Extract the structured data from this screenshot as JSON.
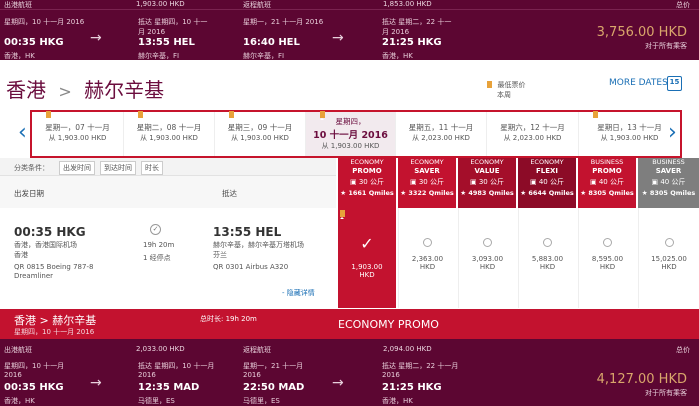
{
  "top_summary": {
    "out_label": "出港航班",
    "out_price": "1,903.00 HKD",
    "ret_label": "返程航班",
    "ret_price": "1,853.00 HKD",
    "total_label": "总价",
    "seg1": {
      "dep_date": "星期四，10 十一月 2016",
      "dep_time": "00:35 HKG",
      "dep_place": "香港，HK",
      "arr_date": "抵达 星期四，10 十一月 2016",
      "arr_time": "13:55 HEL",
      "arr_place": "赫尔辛基，FI"
    },
    "seg2": {
      "dep_date": "星期一，21 十一月 2016",
      "dep_time": "16:40 HEL",
      "dep_place": "赫尔辛基，FI",
      "arr_date": "抵达 星期二，22 十一月 2016",
      "arr_time": "21:25 HKG",
      "arr_place": "香港，HK"
    },
    "total_amount": "3,756.00 HKD",
    "total_note": "对于所有乘客"
  },
  "route": {
    "from": "香港",
    "to": "赫尔辛基",
    "sep": ">"
  },
  "legend": {
    "lowest_fare": "最低票价",
    "this_week": "本周"
  },
  "more_dates": "MORE DATES",
  "calendar_day": "15",
  "dates": [
    {
      "day": "星期一，07 十一月",
      "price": "从 1,903.00 HKD",
      "bookmark": true
    },
    {
      "day": "星期二，08 十一月",
      "price": "从 1,903.00 HKD",
      "bookmark": true
    },
    {
      "day": "星期三，09 十一月",
      "price": "从 1,903.00 HKD",
      "bookmark": true
    },
    {
      "day_line1": "星期四，",
      "day_line2": "10 十一月 2016",
      "price": "从 1,903.00 HKD",
      "bookmark": true,
      "selected": true
    },
    {
      "day": "星期五，11 十一月",
      "price": "从 2,023.00 HKD",
      "bookmark": false
    },
    {
      "day": "星期六，12 十一月",
      "price": "从 2,023.00 HKD",
      "bookmark": false
    },
    {
      "day": "星期日，13 十一月",
      "price": "从 1,903.00 HKD",
      "bookmark": true
    }
  ],
  "sort": {
    "label": "分类条件：",
    "opts": [
      "出发时间",
      "到达时间",
      "时长"
    ]
  },
  "cols": {
    "dep": "出发日期",
    "arr": "抵达"
  },
  "fares": [
    {
      "cabin": "ECONOMY",
      "name": "PROMO",
      "bag": "30 公斤",
      "miles": "1661 Qmiles",
      "color": "#c3122f"
    },
    {
      "cabin": "ECONOMY",
      "name": "SAVER",
      "bag": "30 公斤",
      "miles": "3322 Qmiles",
      "color": "#c3122f"
    },
    {
      "cabin": "ECONOMY",
      "name": "VALUE",
      "bag": "30 公斤",
      "miles": "4983 Qmiles",
      "color": "#a40e2a"
    },
    {
      "cabin": "ECONOMY",
      "name": "FLEXI",
      "bag": "40 公斤",
      "miles": "6644 Qmiles",
      "color": "#8c0b27"
    },
    {
      "cabin": "BUSINESS",
      "name": "PROMO",
      "bag": "40 公斤",
      "miles": "8305 Qmiles",
      "color": "#c3122f"
    },
    {
      "cabin": "BUSINESS",
      "name": "SAVER",
      "bag": "40 公斤",
      "miles": "8305 Qmiles",
      "color": "#7e7e7e"
    }
  ],
  "flight": {
    "dep_time": "00:35 HKG",
    "dep_airport": "香港，香港国际机场",
    "dep_city": "香港",
    "dep_flight": "QR 0815 Boeing 787-8 Dreamliner",
    "duration": "19h 20m",
    "stops": "1 经停点",
    "arr_time": "13:55 HEL",
    "arr_airport": "赫尔辛基，赫尔辛基万塔机场",
    "arr_city": "芬兰",
    "arr_flight": "QR 0301 Airbus A320",
    "hide": "- 隐藏详情"
  },
  "prices": [
    {
      "amount": "1,903.00",
      "cur": "HKD",
      "selected": true
    },
    {
      "amount": "2,363.00",
      "cur": "HKD"
    },
    {
      "amount": "3,093.00",
      "cur": "HKD"
    },
    {
      "amount": "5,883.00",
      "cur": "HKD"
    },
    {
      "amount": "8,595.00",
      "cur": "HKD"
    },
    {
      "amount": "15,025.00",
      "cur": "HKD"
    }
  ],
  "selected_bar": {
    "route": "香港 > 赫尔辛基",
    "date": "星期四，10 十一月 2016",
    "duration": "总时长: 19h 20m",
    "fare": "ECONOMY PROMO"
  },
  "bottom_summary": {
    "out_label": "出港航班",
    "out_price": "2,033.00 HKD",
    "ret_label": "返程航班",
    "ret_price": "2,094.00 HKD",
    "total_label": "总价",
    "seg1": {
      "dep_date": "星期四，10 十一月 2016",
      "dep_time": "00:35 HKG",
      "dep_place": "香港，HK",
      "arr_date": "抵达 星期四，10 十一月 2016",
      "arr_time": "12:35 MAD",
      "arr_place": "马德里，ES"
    },
    "seg2": {
      "dep_date": "星期一，21 十一月 2016",
      "dep_time": "22:50 MAD",
      "dep_place": "马德里，ES",
      "arr_date": "抵达 星期二，22 十一月 2016",
      "arr_time": "21:25 HKG",
      "arr_place": "香港，HK"
    },
    "total_amount": "4,127.00 HKD",
    "total_note": "对于所有乘客"
  },
  "colors": {
    "maroon": "#5c0632",
    "red": "#c3122f",
    "gold": "#d9a66b",
    "bookmark": "#e8a23a"
  }
}
